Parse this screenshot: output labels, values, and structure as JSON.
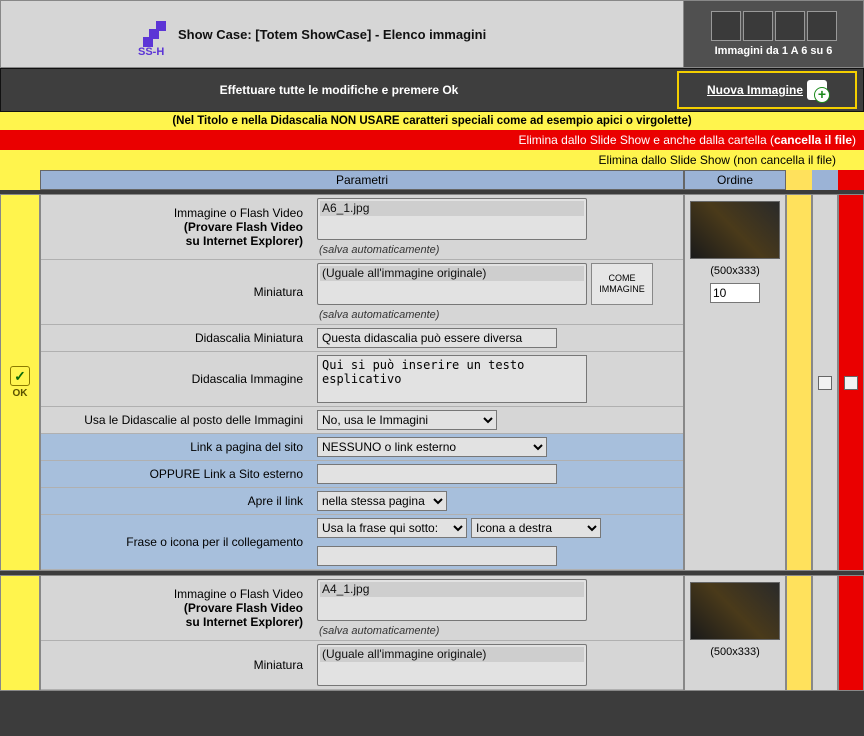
{
  "header": {
    "logo_label": "SS-H",
    "title": "Show Case:  [Totem ShowCase] - Elenco immagini",
    "counter": "Immagini da 1 A 6 su 6"
  },
  "action_bar": {
    "message": "Effettuare tutte le modifiche e premere Ok",
    "new_image_label": "Nuova Immagine"
  },
  "warn_bar": "(Nel Titolo e nella Didascalia NON USARE caratteri speciali come ad esempio apici o virgolette)",
  "delete_bar1_prefix": "Elimina dallo Slide Show e anche dalla cartella (",
  "delete_bar1_bold": "cancella il file",
  "delete_bar1_suffix": ")",
  "delete_bar2": "Elimina dallo Slide Show (non cancella il file)",
  "columns": {
    "params": "Parametri",
    "order": "Ordine"
  },
  "labels": {
    "img_or_flash_1": "Immagine o Flash Video",
    "img_or_flash_2": "(Provare Flash Video",
    "img_or_flash_3": "su Internet Explorer)",
    "miniature": "Miniatura",
    "auto_save": "(salva automaticamente)",
    "did_min": "Didascalia Miniatura",
    "did_img": "Didascalia Immagine",
    "use_did": "Usa le Didascalie al posto delle Immagini",
    "link_page": "Link a pagina del sito",
    "oppure": "OPPURE Link a Sito esterno",
    "open_link": "Apre il link",
    "phrase_icon": "Frase o icona per il collegamento",
    "thumb_btn": "COME IMMAGINE",
    "ok": "OK"
  },
  "options": {
    "miniature_sel": "(Uguale all'immagine originale)",
    "use_did_sel": "No, usa le Immagini",
    "link_page_sel": "NESSUNO o link esterno",
    "open_link_sel": "nella stessa pagina",
    "phrase_sel1": "Usa la frase qui sotto:",
    "phrase_sel2": "Icona a destra"
  },
  "row1": {
    "image_file": "A6_1.jpg",
    "did_min_val": "Questa didascalia può essere diversa",
    "did_img_val": "Qui si può inserire un testo esplicativo",
    "ext_link": "",
    "phrase_input": "",
    "dim": "(500x333)",
    "order": "10"
  },
  "row2": {
    "image_file": "A4_1.jpg",
    "dim": "(500x333)"
  }
}
